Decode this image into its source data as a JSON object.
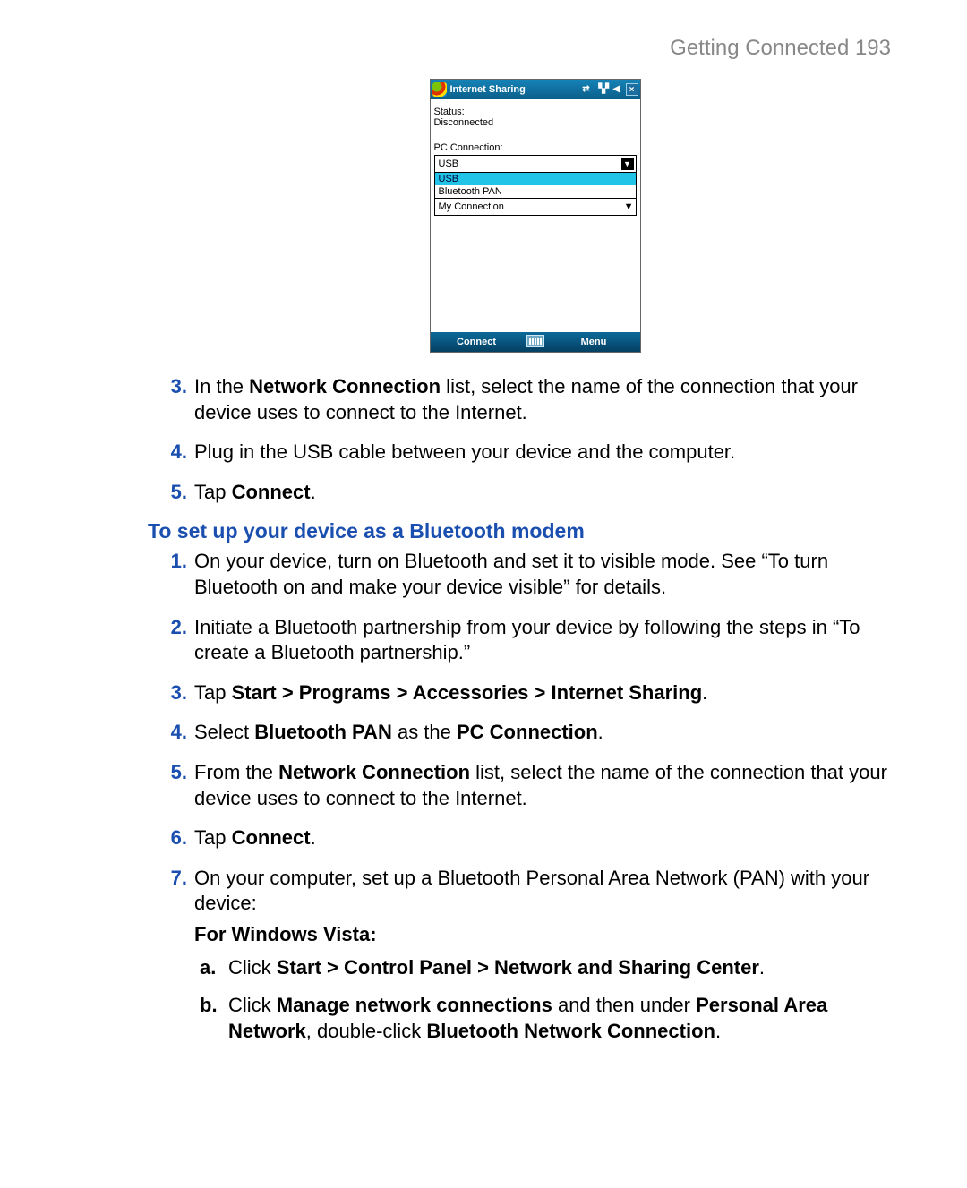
{
  "header": {
    "title": "Getting Connected  193"
  },
  "device": {
    "title": "Internet Sharing",
    "status_label": "Status:",
    "status_value": "Disconnected",
    "pc_conn_label": "PC Connection:",
    "pc_conn_selected": "USB",
    "options": {
      "usb": "USB",
      "bt": "Bluetooth PAN"
    },
    "net_conn_value": "My Connection",
    "soft_left": "Connect",
    "soft_right": "Menu"
  },
  "list1": {
    "i3": {
      "num": "3.",
      "pre": "In the ",
      "b1": "Network Connection",
      "post": " list, select the name of the connection that your device uses to connect to the Internet."
    },
    "i4": {
      "num": "4.",
      "text": "Plug in the USB cable between your device and the computer."
    },
    "i5": {
      "num": "5.",
      "pre": "Tap ",
      "b1": "Connect",
      "post": "."
    }
  },
  "section_title": "To set up your device as a Bluetooth modem",
  "list2": {
    "i1": {
      "num": "1.",
      "text": "On your device, turn on Bluetooth and set it to visible mode. See “To turn Bluetooth on and make your device visible” for details."
    },
    "i2": {
      "num": "2.",
      "text": "Initiate a Bluetooth partnership from your device by following the steps in “To create a Bluetooth partnership.”"
    },
    "i3": {
      "num": "3.",
      "pre": "Tap ",
      "b1": "Start > Programs > Accessories > Internet Sharing",
      "post": "."
    },
    "i4": {
      "num": "4.",
      "pre": "Select ",
      "b1": "Bluetooth PAN",
      "mid": " as the ",
      "b2": "PC Connection",
      "post": "."
    },
    "i5": {
      "num": "5.",
      "pre": "From the ",
      "b1": "Network Connection",
      "post": " list, select the name of the connection that your device uses to connect to the Internet."
    },
    "i6": {
      "num": "6.",
      "pre": "Tap ",
      "b1": "Connect",
      "post": "."
    },
    "i7": {
      "num": "7.",
      "text": "On your computer, set up a Bluetooth Personal Area Network (PAN) with your device:",
      "subhead": "For Windows Vista:",
      "a": {
        "letter": "a.",
        "pre": "Click ",
        "b1": "Start > Control Panel > Network and Sharing Center",
        "post": "."
      },
      "b": {
        "letter": "b.",
        "pre": "Click ",
        "b1": "Manage network connections",
        "mid": " and then under ",
        "b2": "Personal Area Network",
        "mid2": ", double-click ",
        "b3": "Bluetooth Network Connection",
        "post": "."
      }
    }
  }
}
